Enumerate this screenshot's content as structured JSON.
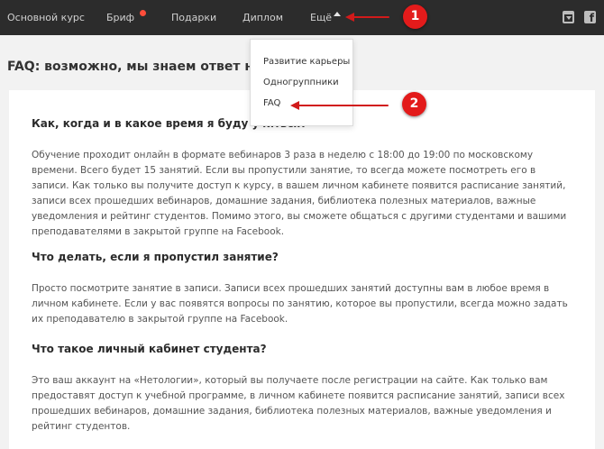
{
  "nav": {
    "items": [
      {
        "label": "Основной курс"
      },
      {
        "label": "Бриф"
      },
      {
        "label": "Подарки"
      },
      {
        "label": "Диплом"
      },
      {
        "label": "Ещё"
      }
    ],
    "brief_dot_color": "#ff4d3a",
    "right_icons": [
      "calendar-download-icon",
      "facebook-icon"
    ],
    "fb_glyph": "f"
  },
  "dropdown": {
    "items": [
      {
        "label": "Развитие карьеры"
      },
      {
        "label": "Одногруппники"
      },
      {
        "label": "FAQ"
      }
    ]
  },
  "annotations": {
    "marker_1": "1",
    "marker_2": "2",
    "color": "#e31b1b"
  },
  "page": {
    "title": "FAQ: возможно, мы знаем ответ на ваш вопрос"
  },
  "faq": [
    {
      "question": "Как, когда и в какое время я буду учиться?",
      "answer": "Обучение проходит онлайн в формате вебинаров 3 раза в неделю с 18:00 до 19:00 по московскому времени. Всего будет 15 занятий. Если вы пропустили занятие, то всегда можете посмотреть его в записи. Как только вы получите доступ к курсу, в вашем личном кабинете появится расписание занятий, записи всех прошедших вебинаров, домашние задания, библиотека полезных материалов, важные уведомления и рейтинг студентов. Помимо этого, вы сможете общаться с другими студентами и вашими преподавателями в закрытой группе на Facebook."
    },
    {
      "question": "Что делать, если я пропустил занятие?",
      "answer": "Просто посмотрите занятие в записи. Записи всех прошедших занятий доступны вам в любое время в личном кабинете. Если у вас появятся вопросы по занятию, которое вы пропустили, всегда можно задать их преподавателю в закрытой группе на Facebook."
    },
    {
      "question": "Что такое личный кабинет студента?",
      "answer": "Это ваш аккаунт на «Нетологии», который вы получаете после регистрации на сайте. Как только вам предоставят доступ к учебной программе, в личном кабинете появится расписание занятий, записи всех прошедших вебинаров, домашние задания, библиотека полезных материалов, важные уведомления и рейтинг студентов."
    }
  ]
}
